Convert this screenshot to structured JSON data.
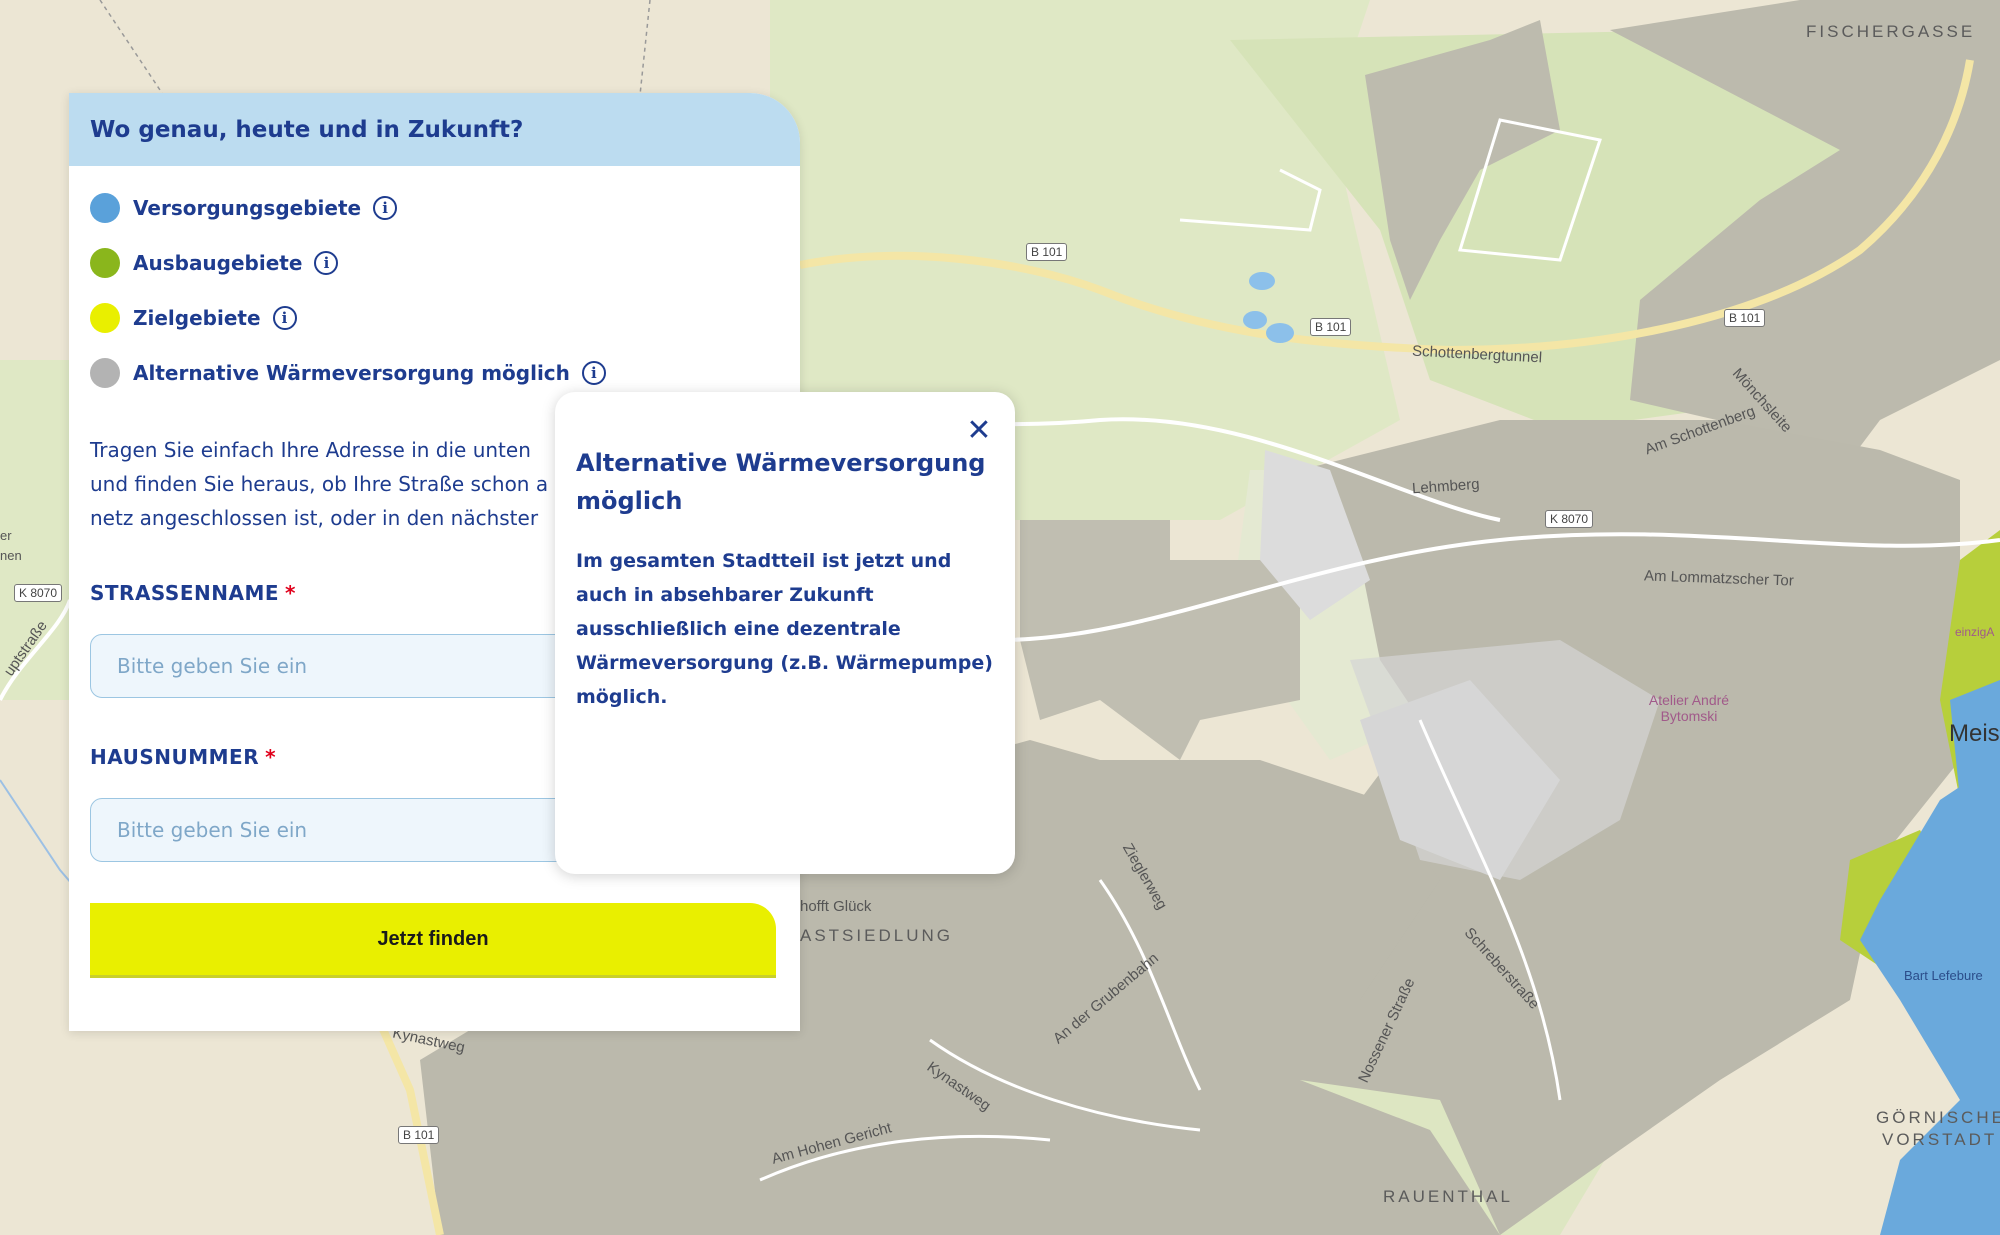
{
  "map": {
    "labels": {
      "fischergasse": "FISCHERGASSE",
      "b101_a": "B 101",
      "b101_b": "B 101",
      "b101_c": "B 101",
      "b101_d": "B 101",
      "schottenbergtunnel": "Schottenbergtunnel",
      "moenchsleite": "Mönchsleite",
      "am_schottenberg": "Am Schottenberg",
      "lehmberg": "Lehmberg",
      "k8070_a": "K 8070",
      "k8070_b": "K 8070",
      "am_lommatzscher_tor": "Am Lommatzscher Tor",
      "atelier": "Atelier André Bytomski",
      "meis": "Meis",
      "einzig": "einzigA",
      "bart_lefebure": "Bart Lefebure",
      "hofft_glueck": "hofft Glück",
      "astsiedlung": "ASTSIEDLUNG",
      "zieglerweg": "Zieglerweg",
      "an_der_grubenbahn": "An der Grubenbahn",
      "schreberstrasse": "Schreberstraße",
      "nossener_strasse": "Nossener Straße",
      "kynastweg_a": "Kynastweg",
      "kynastweg_b": "Kynastweg",
      "am_hohen_gericht": "Am Hohen Gericht",
      "rauenthal": "RAUENTHAL",
      "goernische": "GÖRNISCHE",
      "vorstadt": "VORSTADT",
      "hauptstrasse": "uptstraße",
      "left_edge_a": "er",
      "left_edge_b": "nen"
    },
    "colors": {
      "base": "#ece6d4",
      "green_area": "#dce7c0",
      "alt_area": "#bdbbae",
      "versorgung": "#6aa9dc",
      "ausbau": "#b7cf3b",
      "ziel": "#e9ef00"
    }
  },
  "panel": {
    "title": "Wo genau, heute und in Zukunft?",
    "legend": [
      {
        "label": "Versorgungsgebiete",
        "color": "#5aa1da"
      },
      {
        "label": "Ausbaugebiete",
        "color": "#8ab61c"
      },
      {
        "label": "Zielgebiete",
        "color": "#e9ef00"
      },
      {
        "label": "Alternative Wärmeversorgung möglich",
        "color": "#b3b3b3"
      }
    ],
    "info_glyph": "i",
    "intro_lines": [
      "Tragen Sie einfach Ihre Adresse in die unten",
      "und finden Sie heraus, ob Ihre Straße schon a",
      "netz angeschlossen ist, oder in den nächster"
    ],
    "street_label": "STRASSENNAME",
    "number_label": "HAUSNUMMER",
    "required_mark": "*",
    "street_placeholder": "Bitte geben Sie ein",
    "number_placeholder": "Bitte geben Sie ein",
    "submit_label": "Jetzt finden"
  },
  "popover": {
    "title": "Alternative Wärmeversorgung möglich",
    "body": "Im gesamten Stadtteil ist jetzt und auch in absehbarer Zukunft ausschließlich eine dezentrale Wärmeversorgung (z.B. Wärmepumpe) möglich.",
    "close_glyph": "✕"
  }
}
